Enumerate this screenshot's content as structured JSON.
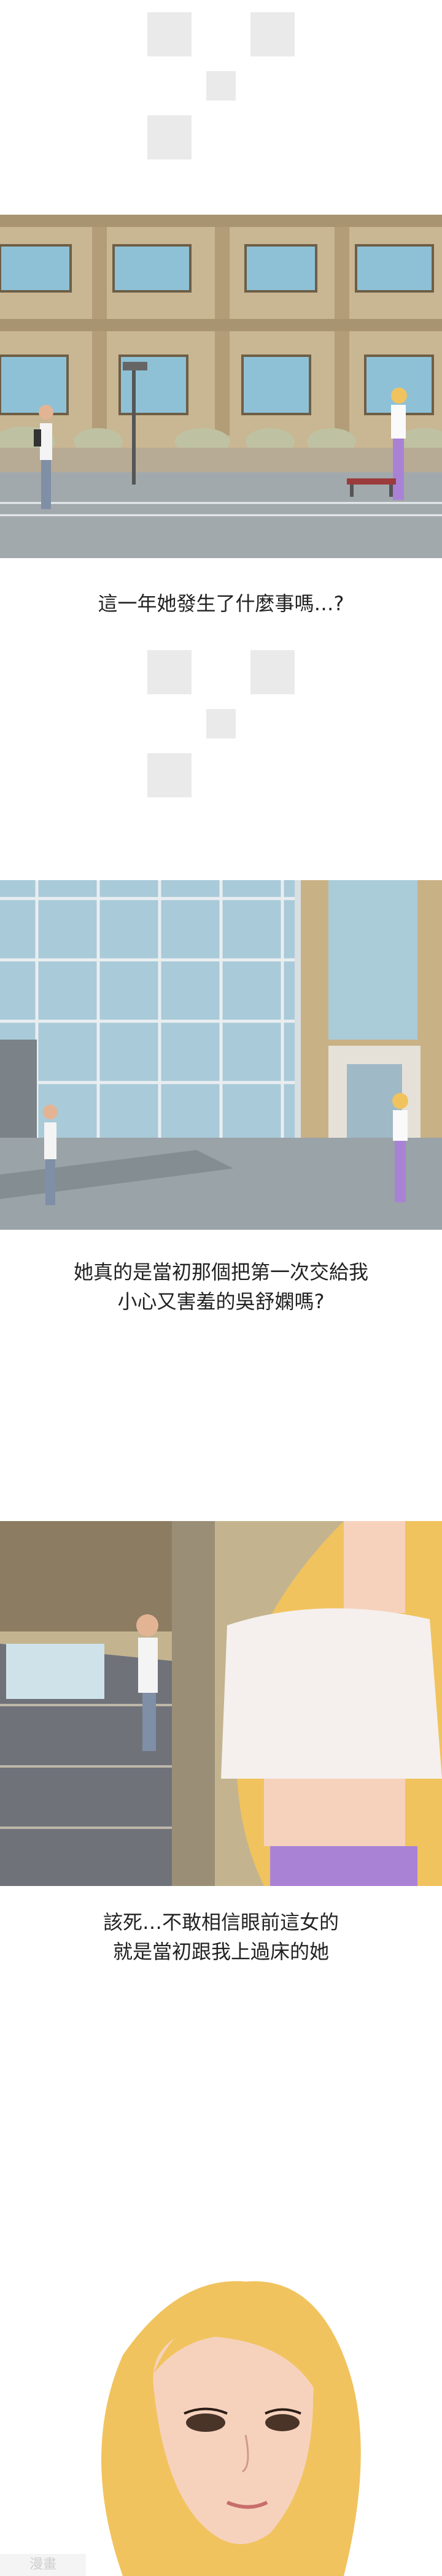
{
  "captions": {
    "one": "這一年她發生了什麼事嗎…?",
    "two_line1": "她真的是當初那個把第一次交給我",
    "two_line2": "小心又害羞的吳舒嫻嗎?",
    "three_line1": "該死…不敢相信眼前這女的",
    "three_line2": "就是當初跟我上過床的她"
  },
  "watermark": "漫畫",
  "colors": {
    "sky": "#c7ddea",
    "wall": "#b9a585",
    "window": "#8fc1d6",
    "pavement": "#9aa2a8",
    "skin": "#f6d2bd",
    "hair": "#f1c35e",
    "purple": "#a982d6"
  }
}
